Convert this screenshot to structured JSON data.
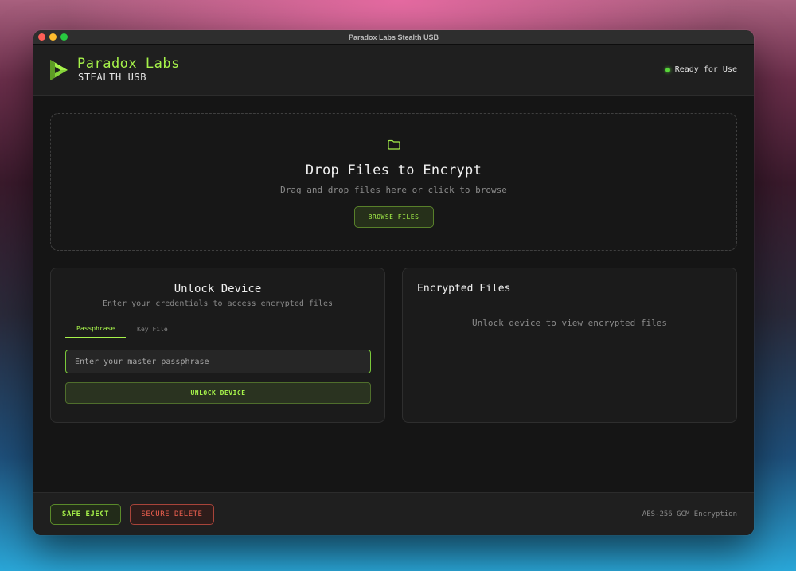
{
  "window": {
    "title": "Paradox Labs Stealth USB"
  },
  "header": {
    "brand_name": "Paradox Labs",
    "brand_sub": "STEALTH USB",
    "logo_icon": "play-triangle-logo-icon",
    "status_text": "Ready for Use",
    "status_color": "#58d63a"
  },
  "dropzone": {
    "icon": "folder-icon",
    "title": "Drop Files to Encrypt",
    "subtitle": "Drag and drop files here or click to browse",
    "browse_label": "BROWSE FILES"
  },
  "unlock": {
    "title": "Unlock Device",
    "subtitle": "Enter your credentials to access encrypted files",
    "tabs": [
      {
        "label": "Passphrase",
        "active": true
      },
      {
        "label": "Key File",
        "active": false
      }
    ],
    "input_placeholder": "Enter your master passphrase",
    "input_value": "",
    "unlock_label": "UNLOCK DEVICE"
  },
  "files": {
    "title": "Encrypted Files",
    "empty_text": "Unlock device to view encrypted files"
  },
  "footer": {
    "eject_label": "SAFE EJECT",
    "delete_label": "SECURE DELETE",
    "encryption_label": "AES-256 GCM Encryption"
  },
  "colors": {
    "accent": "#a6f24a",
    "danger": "#f06050",
    "background": "#151515"
  }
}
